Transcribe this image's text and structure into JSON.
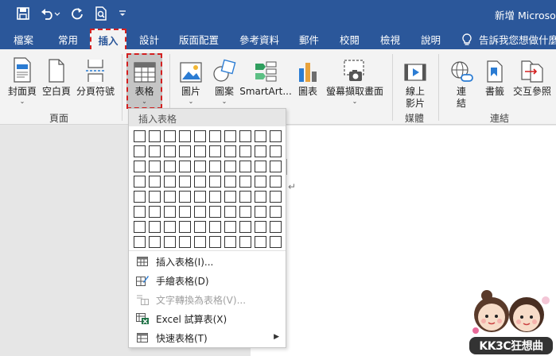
{
  "window": {
    "title": "新增 Microsoft"
  },
  "quick_access": [
    {
      "icon": "save-icon"
    },
    {
      "icon": "undo-icon"
    },
    {
      "icon": "redo-icon"
    },
    {
      "icon": "print-preview-icon"
    },
    {
      "icon": "customize-qat-icon"
    }
  ],
  "tabs": {
    "file": "檔案",
    "home": "常用",
    "insert": "插入",
    "design": "設計",
    "layout": "版面配置",
    "references": "參考資料",
    "mailings": "郵件",
    "review": "校閱",
    "view": "檢視",
    "help": "說明"
  },
  "tell_me": {
    "text": "告訴我您想做什麼"
  },
  "ribbon": {
    "cover_page": "封面頁",
    "blank_page": "空白頁",
    "page_break": "分頁符號",
    "table": "表格",
    "pictures": "圖片",
    "shapes": "圖案",
    "smartart": "SmartArt...",
    "chart": "圖表",
    "screenshot": "螢幕擷取畫面",
    "online_video_1": "線上",
    "online_video_2": "影片",
    "link_1": "連",
    "link_2": "結",
    "bookmark": "書籤",
    "cross_ref": "交互參照",
    "group_pages": "頁面",
    "group_media": "媒體",
    "group_links": "連結"
  },
  "dropdown": {
    "header": "插入表格",
    "grid_cols": 10,
    "grid_rows": 8,
    "items": [
      {
        "label": "插入表格(I)...",
        "icon": "insert-table-icon",
        "disabled": false
      },
      {
        "label": "手繪表格(D)",
        "icon": "draw-table-icon",
        "disabled": false
      },
      {
        "label": "文字轉換為表格(V)...",
        "icon": "convert-text-icon",
        "disabled": true
      },
      {
        "label": "Excel 試算表(X)",
        "icon": "excel-sheet-icon",
        "disabled": false
      },
      {
        "label": "快速表格(T)",
        "icon": "quick-tables-icon",
        "disabled": false
      }
    ]
  },
  "document": {
    "paragraph_mark": "↵"
  },
  "watermark": {
    "text": "KK3C狂想曲"
  },
  "colors": {
    "brand": "#2b579a",
    "highlight": "#d42020"
  }
}
